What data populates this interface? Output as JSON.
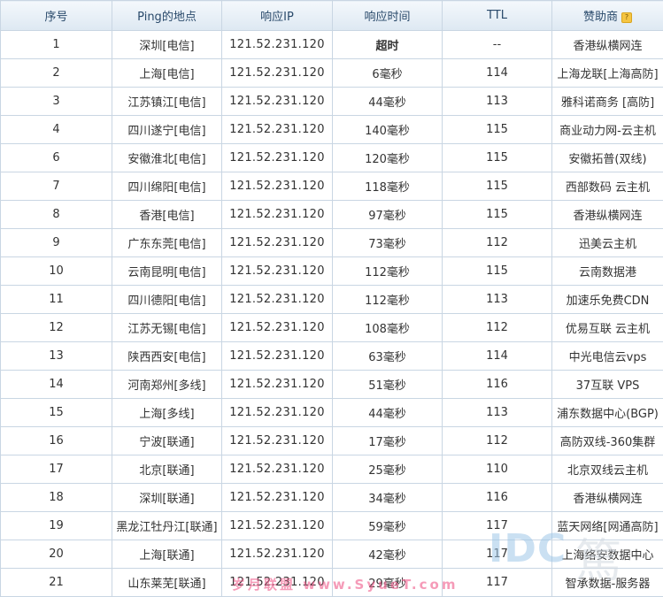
{
  "headers": {
    "index": "序号",
    "location": "Ping的地点",
    "ip": "响应IP",
    "time": "响应时间",
    "ttl": "TTL",
    "sponsor": "赞助商",
    "sponsor_icon": "info-badge-icon"
  },
  "rows": [
    {
      "index": "1",
      "location": "深圳[电信]",
      "ip": "121.52.231.120",
      "time": "超时",
      "ttl": "--",
      "sponsor": "香港纵横网连"
    },
    {
      "index": "2",
      "location": "上海[电信]",
      "ip": "121.52.231.120",
      "time": "6毫秒",
      "ttl": "114",
      "sponsor": "上海龙联[上海高防]"
    },
    {
      "index": "3",
      "location": "江苏镇江[电信]",
      "ip": "121.52.231.120",
      "time": "44毫秒",
      "ttl": "113",
      "sponsor": "雅科诺商务 [高防]"
    },
    {
      "index": "4",
      "location": "四川遂宁[电信]",
      "ip": "121.52.231.120",
      "time": "140毫秒",
      "ttl": "115",
      "sponsor": "商业动力网-云主机"
    },
    {
      "index": "6",
      "location": "安徽淮北[电信]",
      "ip": "121.52.231.120",
      "time": "120毫秒",
      "ttl": "115",
      "sponsor": "安徽拓普(双线)"
    },
    {
      "index": "7",
      "location": "四川绵阳[电信]",
      "ip": "121.52.231.120",
      "time": "118毫秒",
      "ttl": "115",
      "sponsor": "西部数码 云主机"
    },
    {
      "index": "8",
      "location": "香港[电信]",
      "ip": "121.52.231.120",
      "time": "97毫秒",
      "ttl": "115",
      "sponsor": "香港纵横网连"
    },
    {
      "index": "9",
      "location": "广东东莞[电信]",
      "ip": "121.52.231.120",
      "time": "73毫秒",
      "ttl": "112",
      "sponsor": "迅美云主机"
    },
    {
      "index": "10",
      "location": "云南昆明[电信]",
      "ip": "121.52.231.120",
      "time": "112毫秒",
      "ttl": "115",
      "sponsor": "云南数据港"
    },
    {
      "index": "11",
      "location": "四川德阳[电信]",
      "ip": "121.52.231.120",
      "time": "112毫秒",
      "ttl": "113",
      "sponsor": "加速乐免费CDN"
    },
    {
      "index": "12",
      "location": "江苏无锡[电信]",
      "ip": "121.52.231.120",
      "time": "108毫秒",
      "ttl": "112",
      "sponsor": "优易互联 云主机"
    },
    {
      "index": "13",
      "location": "陕西西安[电信]",
      "ip": "121.52.231.120",
      "time": "63毫秒",
      "ttl": "114",
      "sponsor": "中光电信云vps"
    },
    {
      "index": "14",
      "location": "河南郑州[多线]",
      "ip": "121.52.231.120",
      "time": "51毫秒",
      "ttl": "116",
      "sponsor": "37互联 VPS"
    },
    {
      "index": "15",
      "location": "上海[多线]",
      "ip": "121.52.231.120",
      "time": "44毫秒",
      "ttl": "113",
      "sponsor": "浦东数据中心(BGP)"
    },
    {
      "index": "16",
      "location": "宁波[联通]",
      "ip": "121.52.231.120",
      "time": "17毫秒",
      "ttl": "112",
      "sponsor": "高防双线-360集群"
    },
    {
      "index": "17",
      "location": "北京[联通]",
      "ip": "121.52.231.120",
      "time": "25毫秒",
      "ttl": "110",
      "sponsor": "北京双线云主机"
    },
    {
      "index": "18",
      "location": "深圳[联通]",
      "ip": "121.52.231.120",
      "time": "34毫秒",
      "ttl": "116",
      "sponsor": "香港纵横网连"
    },
    {
      "index": "19",
      "location": "黑龙江牡丹江[联通]",
      "ip": "121.52.231.120",
      "time": "59毫秒",
      "ttl": "117",
      "sponsor": "蓝天网络[网通高防]"
    },
    {
      "index": "20",
      "location": "上海[联通]",
      "ip": "121.52.231.120",
      "time": "42毫秒",
      "ttl": "117",
      "sponsor": "上海络安数据中心"
    },
    {
      "index": "21",
      "location": "山东莱芜[联通]",
      "ip": "121.52.231.120",
      "time": "29毫秒",
      "ttl": "117",
      "sponsor": "智承数据-服务器"
    }
  ],
  "colors": {
    "ip": "#2a9a2a",
    "sponsor": "#1a9a1a",
    "timeout": "#e02020",
    "header_text": "#2a4a6b",
    "border": "#c9d6e3"
  },
  "watermarks": {
    "idc": "IDC",
    "bottom": "岁月联盟 www.SyueT.com"
  }
}
